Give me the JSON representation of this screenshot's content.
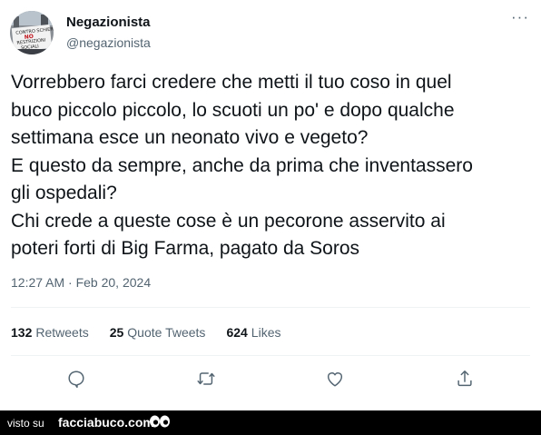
{
  "tweet": {
    "author_name": "Negazionista",
    "author_handle": "@negazionista",
    "avatar_caption_lines": [
      "CONTRO SCHIERE",
      "NO",
      "RESTRIZIONI",
      "SOCIALI"
    ],
    "text_lines": [
      "Vorrebbero farci credere che metti il tuo coso in quel",
      "buco piccolo piccolo, lo scuoti un po' e dopo qualche",
      "settimana esce un neonato vivo e vegeto?",
      "E questo da sempre, anche da prima che inventassero",
      "gli ospedali?",
      "Chi crede a queste cose è un pecorone asservito ai",
      "poteri forti di Big Farma, pagato da Soros"
    ],
    "timestamp": "12:27 AM · Feb 20, 2024",
    "more_label": "···",
    "stats": {
      "retweets_count": "132",
      "retweets_label": "Retweets",
      "quotes_count": "25",
      "quotes_label": "Quote Tweets",
      "likes_count": "624",
      "likes_label": "Likes"
    },
    "actions": [
      "reply-icon",
      "retweet-icon",
      "like-icon",
      "share-icon"
    ]
  },
  "footer": {
    "prefix": "visto su",
    "brand": "facciabuco.com"
  },
  "colors": {
    "text_primary": "#0f1419",
    "text_secondary": "#536471",
    "divider": "#eff3f4",
    "footer_bg": "#000000"
  }
}
